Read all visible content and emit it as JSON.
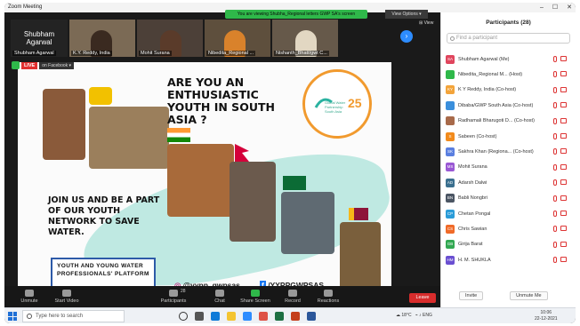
{
  "window": {
    "title": "Zoom Meeting",
    "controls": [
      "–",
      "☐",
      "✕"
    ]
  },
  "banner": {
    "text": "You are viewing Shubha_Regional letters GWP SA's screen",
    "view_options": "View Options ▾"
  },
  "thumbnails": [
    {
      "big": "Shubham Agarwal",
      "name": "Shubham Agarwal"
    },
    {
      "name": "K.Y. Reddy, India"
    },
    {
      "name": "Mohit Surana"
    },
    {
      "name": "Nibedita_Regional ..."
    },
    {
      "name": "Nishanth_Bhatt/gwt C..."
    }
  ],
  "view_label": "⊞ View",
  "live": {
    "badge": "LIVE",
    "on": "on Facebook ▾"
  },
  "poster": {
    "headline": "ARE YOU AN ENTHUSIASTIC YOUTH IN SOUTH ASIA ?",
    "join": "JOIN US AND BE A PART OF OUR YOUTH NETWORK TO SAVE WATER.",
    "box": "YOUTH AND YOUNG WATER PROFESSIONALS' PLATFORM",
    "instagram": "@yypp_gwpsas",
    "facebook": "/YYPPGWPSAS",
    "logo_text": "Global Water Partnership South Asia",
    "logo_number": "25"
  },
  "toolbar": {
    "items": [
      "Unmute",
      "Start Video",
      "Participants",
      "Chat",
      "Share Screen",
      "Record",
      "Reactions"
    ],
    "participants_count": "28",
    "leave": "Leave"
  },
  "panel": {
    "title": "Participants (28)",
    "search_placeholder": "Find a participant",
    "people": [
      {
        "initials": "SA",
        "color": "#e0455d",
        "name": "Shubham Agarwal (Me)"
      },
      {
        "initials": "",
        "color": "#2fb84a",
        "name": "Nibedita_Regional M... (Host)"
      },
      {
        "initials": "KY",
        "color": "#f3a43a",
        "name": "K Y Reddy, India (Co-host)"
      },
      {
        "initials": "",
        "color": "#3b8fdc",
        "name": "Dibaba/GWP South Asia (Co-host)"
      },
      {
        "initials": "",
        "color": "#a86a4a",
        "name": "Radhamali Bharugoti D... (Co-host)"
      },
      {
        "initials": "S",
        "color": "#f28b1d",
        "name": "Sabeen (Co-host)"
      },
      {
        "initials": "SK",
        "color": "#5a7fe0",
        "name": "Sakhra Khan (Regiona... (Co-host)"
      },
      {
        "initials": "MS",
        "color": "#9a58d4",
        "name": "Mohit Surana"
      },
      {
        "initials": "AD",
        "color": "#3a6f8e",
        "name": "Adarsh Dalwi"
      },
      {
        "initials": "BN",
        "color": "#4b5563",
        "name": "Babli Nongbri"
      },
      {
        "initials": "CP",
        "color": "#2b9cd8",
        "name": "Chetan Pongal"
      },
      {
        "initials": "CS",
        "color": "#f06a28",
        "name": "Chris Sawian"
      },
      {
        "initials": "GB",
        "color": "#32a852",
        "name": "Girija Barat"
      },
      {
        "initials": "HM",
        "color": "#6a4fd1",
        "name": "H. M. SHUKLA"
      }
    ],
    "invite": "Invite",
    "unmute_me": "Unmute Me"
  },
  "taskbar": {
    "search": "Type here to search",
    "weather": "18°C",
    "lang": "ENG",
    "time": "10:06",
    "date": "22-12-2021"
  }
}
